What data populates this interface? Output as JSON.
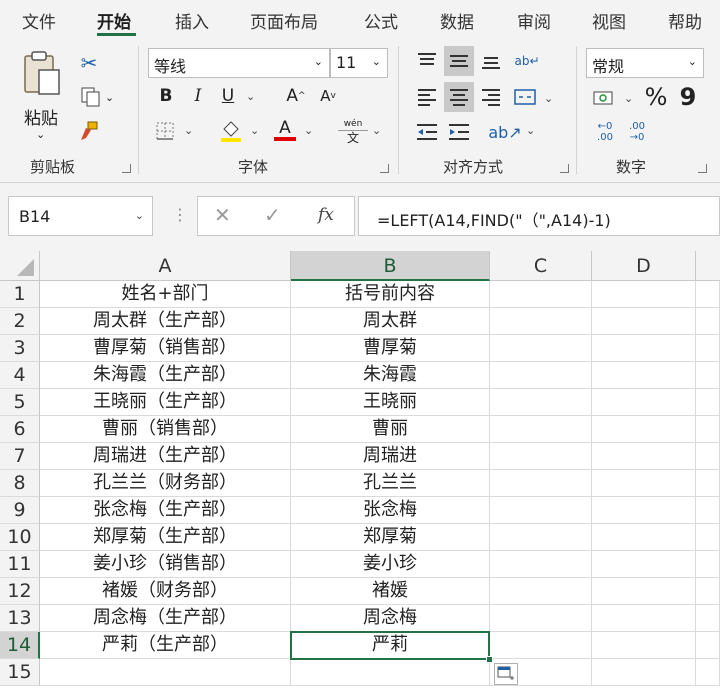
{
  "tabs": [
    "文件",
    "开始",
    "插入",
    "页面布局",
    "公式",
    "数据",
    "审阅",
    "视图",
    "帮助"
  ],
  "ribbon": {
    "paste_label": "粘贴",
    "clipboard_label": "剪贴板",
    "font_name": "等线",
    "font_size": "11",
    "font_label": "字体",
    "align_label": "对齐方式",
    "number_format": "常规",
    "number_label": "数字",
    "percent": "%",
    "comma": "9",
    "wen_top": "wén",
    "wen_bottom": "文",
    "bold": "B",
    "italic": "I",
    "underline": "U",
    "grow": "A",
    "shrink": "A",
    "fontcolor": "A",
    "inc_dec": "←0 .00",
    "dec_dec": ".00 →0"
  },
  "formula_bar": {
    "name_box": "B14",
    "fx": "fx",
    "formula": "=LEFT(A14,FIND(\"（\",A14)-1)"
  },
  "columns": [
    "A",
    "B",
    "C",
    "D"
  ],
  "rows": [
    {
      "n": "1",
      "a": "姓名+部门",
      "b": "括号前内容"
    },
    {
      "n": "2",
      "a": "周太群（生产部）",
      "b": "周太群"
    },
    {
      "n": "3",
      "a": "曹厚菊（销售部）",
      "b": "曹厚菊"
    },
    {
      "n": "4",
      "a": "朱海霞（生产部）",
      "b": "朱海霞"
    },
    {
      "n": "5",
      "a": "王晓丽（生产部）",
      "b": "王晓丽"
    },
    {
      "n": "6",
      "a": "曹丽（销售部）",
      "b": "曹丽"
    },
    {
      "n": "7",
      "a": "周瑞进（生产部）",
      "b": "周瑞进"
    },
    {
      "n": "8",
      "a": "孔兰兰（财务部）",
      "b": "孔兰兰"
    },
    {
      "n": "9",
      "a": "张念梅（生产部）",
      "b": "张念梅"
    },
    {
      "n": "10",
      "a": "郑厚菊（生产部）",
      "b": "郑厚菊"
    },
    {
      "n": "11",
      "a": "姜小珍（销售部）",
      "b": "姜小珍"
    },
    {
      "n": "12",
      "a": "褚媛（财务部）",
      "b": "褚媛"
    },
    {
      "n": "13",
      "a": "周念梅（生产部）",
      "b": "周念梅"
    },
    {
      "n": "14",
      "a": "严莉（生产部）",
      "b": "严莉"
    },
    {
      "n": "15",
      "a": "",
      "b": ""
    }
  ],
  "colors": {
    "accent": "#217346",
    "ribbon_bg": "#f3f3f3"
  }
}
